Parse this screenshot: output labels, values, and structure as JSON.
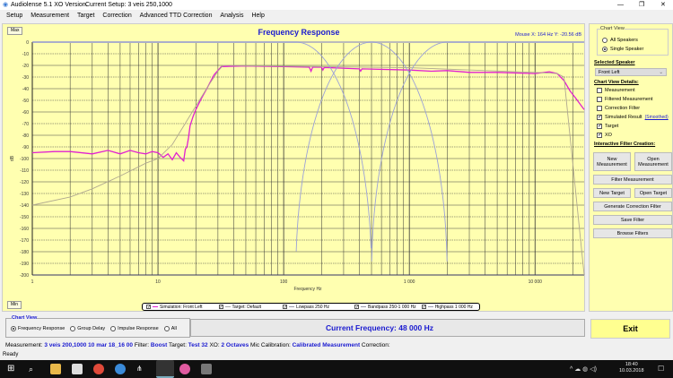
{
  "window": {
    "app_title": "Audiolense 5.1 XO Version.",
    "setup": "Current Setup: 3 veis 250,1000",
    "minimize": "—",
    "restore": "❐",
    "close": "✕"
  },
  "menu": [
    "Setup",
    "Measurement",
    "Target",
    "Correction",
    "Advanced TTD Correction",
    "Analysis",
    "Help"
  ],
  "chart_panel": {
    "max_label": "Max",
    "min_label": "Min",
    "mouse_readout": "Mouse X: 164 Hz   Y: -20.56 dB"
  },
  "legend": [
    {
      "label": "Simulation: Front Left",
      "checked": true,
      "color": "#e020d0"
    },
    {
      "label": "Target: Default",
      "checked": true,
      "color": "#aaa"
    },
    {
      "label": "Lowpass  250 Hz",
      "checked": true,
      "color": "#99a"
    },
    {
      "label": "Bandpass  250-1 000 Hz",
      "checked": true,
      "color": "#99a"
    },
    {
      "label": "Highpass  1 000 Hz",
      "checked": true,
      "color": "#99a"
    }
  ],
  "chart_data": {
    "type": "line",
    "title": "Frequency Response",
    "xlabel": "Frequency Hz",
    "ylabel": "dB",
    "xscale": "log",
    "xlim": [
      1,
      24600
    ],
    "ylim": [
      -200,
      0
    ],
    "xticks": [
      {
        "v": 1,
        "label": "1"
      },
      {
        "v": 10,
        "label": "10"
      },
      {
        "v": 100,
        "label": "100"
      },
      {
        "v": 1000,
        "label": "1 000"
      },
      {
        "v": 10000,
        "label": "10 000"
      }
    ],
    "yticks": [
      0,
      -10,
      -20,
      -30,
      -40,
      -50,
      -60,
      -70,
      -80,
      -90,
      -100,
      -110,
      -120,
      -130,
      -140,
      -150,
      -160,
      -170,
      -180,
      -190,
      -200
    ],
    "grid": true,
    "series": [
      {
        "name": "Simulation: Front Left",
        "color": "#e020d0",
        "points": [
          [
            1,
            -95
          ],
          [
            1.5,
            -94
          ],
          [
            2,
            -94
          ],
          [
            3,
            -96
          ],
          [
            4,
            -93
          ],
          [
            5,
            -96
          ],
          [
            6,
            -93
          ],
          [
            7,
            -95
          ],
          [
            8,
            -96
          ],
          [
            9,
            -94
          ],
          [
            10,
            -95
          ],
          [
            11,
            -99
          ],
          [
            12,
            -96
          ],
          [
            13,
            -101
          ],
          [
            14,
            -95
          ],
          [
            15,
            -99
          ],
          [
            16,
            -102
          ],
          [
            16.5,
            -92
          ],
          [
            17,
            -90
          ],
          [
            17.5,
            -82
          ],
          [
            18,
            -72
          ],
          [
            19,
            -64
          ],
          [
            20,
            -58
          ],
          [
            22,
            -49
          ],
          [
            25,
            -38
          ],
          [
            28,
            -28
          ],
          [
            32,
            -21
          ],
          [
            50,
            -20.5
          ],
          [
            100,
            -21
          ],
          [
            160,
            -21.5
          ],
          [
            165,
            -25
          ],
          [
            170,
            -21.5
          ],
          [
            200,
            -21.5
          ],
          [
            205,
            -24
          ],
          [
            210,
            -21.8
          ],
          [
            400,
            -23
          ],
          [
            410,
            -25
          ],
          [
            420,
            -23
          ],
          [
            1000,
            -24
          ],
          [
            1500,
            -25
          ],
          [
            2000,
            -24.5
          ],
          [
            3000,
            -26
          ],
          [
            5000,
            -26
          ],
          [
            10000,
            -27
          ],
          [
            13000,
            -25.5
          ],
          [
            15000,
            -27
          ],
          [
            17000,
            -33
          ],
          [
            19000,
            -42
          ],
          [
            21000,
            -48
          ],
          [
            24600,
            -58
          ]
        ]
      },
      {
        "name": "Target: Default",
        "color": "#b0a890",
        "points": [
          [
            1,
            -140
          ],
          [
            2,
            -133
          ],
          [
            3,
            -126
          ],
          [
            5,
            -115
          ],
          [
            8,
            -104
          ],
          [
            10,
            -100
          ],
          [
            13,
            -88
          ],
          [
            16,
            -72
          ],
          [
            20,
            -55
          ],
          [
            25,
            -38
          ],
          [
            30,
            -25
          ],
          [
            33,
            -20
          ],
          [
            1000,
            -22
          ],
          [
            10000,
            -26
          ],
          [
            15000,
            -27
          ],
          [
            17000,
            -30
          ],
          [
            24600,
            -200
          ]
        ]
      },
      {
        "name": "Lowpass 250 Hz",
        "color": "#9aa0d8",
        "kind": "lowpass",
        "null_hz": 500
      },
      {
        "name": "Bandpass 250-1 000 Hz",
        "color": "#9aa0d8",
        "kind": "bandpass",
        "null_hz": [
          125,
          2000
        ]
      },
      {
        "name": "Highpass 1 000 Hz",
        "color": "#9aa0d8",
        "kind": "highpass",
        "null_hz": 500
      }
    ]
  },
  "right_panel": {
    "chart_view_group": "Chart View",
    "all_speakers": "All Speakers",
    "single_speaker": "Single Speaker",
    "single_selected": true,
    "selected_speaker_label": "Selected Speaker",
    "selected_speaker": "Front Left",
    "details_label": "Chart View Details:",
    "details": [
      {
        "label": "Measurement",
        "checked": false
      },
      {
        "label": "Filtered Measurement",
        "checked": false
      },
      {
        "label": "Correction Filter",
        "checked": false
      },
      {
        "label": "Simulated Result",
        "checked": true
      },
      {
        "label": "Target",
        "checked": true
      },
      {
        "label": "XO",
        "checked": true
      }
    ],
    "smoothed_link": "(Smoothed)",
    "filter_creation_label": "Interactive Filter Creation:",
    "new_measurement": "New Measurement",
    "open_measurement": "Open Measurement",
    "filter_measurement": "Filter Measurement",
    "new_target": "New Target",
    "open_target": "Open Target",
    "generate": "Generate Correction Filter",
    "save_filter": "Save Filter",
    "browse_filters": "Browse Filters"
  },
  "chart_view": {
    "label": "Chart View",
    "options": [
      "Frequency Response",
      "Group Delay",
      "Impulse Response",
      "All"
    ],
    "selected": 0
  },
  "current_frequency": "Current Frequency: 48 000 Hz",
  "exit": "Exit",
  "info": {
    "measurement_k": "Measurement:",
    "measurement_v": "3 veis 200,1000 10 mar 18_16 00",
    "filter_k": "Filter:",
    "filter_v": "Boost",
    "target_k": "Target:",
    "target_v": "Test 32",
    "xo_k": "XO:",
    "xo_v": "2 Octaves",
    "mic_k": "Mic Calibration:",
    "mic_v": "Calibrated Measurement",
    "corr_k": "Correction:"
  },
  "status": "Ready",
  "taskbar": {
    "time": "18:40",
    "date": "10.03.2018"
  }
}
